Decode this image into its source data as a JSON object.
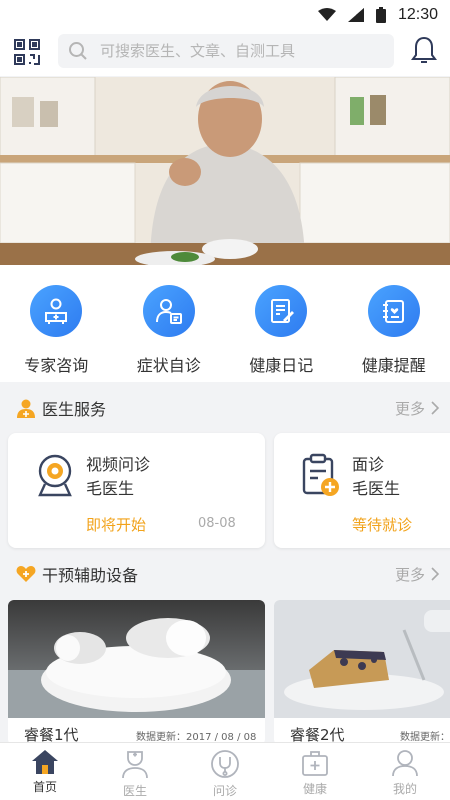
{
  "status_bar": {
    "time": "12:30"
  },
  "search": {
    "placeholder": "可搜索医生、文章、自测工具"
  },
  "quick_actions": [
    {
      "label": "专家咨询",
      "icon": "consult-icon"
    },
    {
      "label": "症状自诊",
      "icon": "self-diagnosis-icon"
    },
    {
      "label": "健康日记",
      "icon": "diary-icon"
    },
    {
      "label": "健康提醒",
      "icon": "reminder-icon"
    }
  ],
  "doctor_service": {
    "title": "医生服务",
    "more": "更多",
    "cards": [
      {
        "type": "视频问诊",
        "doctor": "毛医生",
        "status": "即将开始",
        "date": "08-08"
      },
      {
        "type": "面诊",
        "doctor": "毛医生",
        "status": "等待就诊"
      }
    ]
  },
  "devices": {
    "title": "干预辅助设备",
    "more": "更多",
    "items": [
      {
        "name": "睿餐1代",
        "update": "数据更新：2017 / 08 / 08"
      },
      {
        "name": "睿餐2代",
        "update": "数据更新："
      }
    ]
  },
  "tabs": [
    {
      "label": "首页",
      "active": true
    },
    {
      "label": "医生",
      "active": false
    },
    {
      "label": "问诊",
      "active": false
    },
    {
      "label": "健康",
      "active": false
    },
    {
      "label": "我的",
      "active": false
    }
  ],
  "colors": {
    "primary": "#2e7bf0",
    "accent": "#f2a31b",
    "icon_orange": "#f5a623"
  }
}
